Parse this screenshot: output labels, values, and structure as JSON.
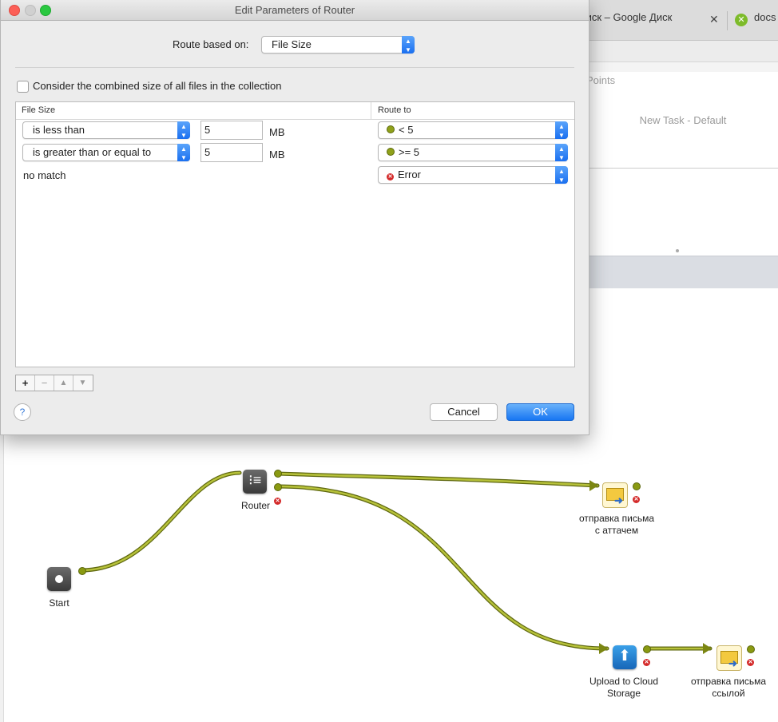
{
  "background_app": {
    "tab_title": "диск – Google Диск",
    "tab_close": "✕",
    "tab2_title": "docs",
    "points_label": "Points",
    "task_title": "New Task - Default"
  },
  "workflow": {
    "start_label": "Start",
    "router_label": "Router",
    "mail_attach_label": "отправка письма с аттачем",
    "upload_label": "Upload to Cloud Storage",
    "mail_link_label": "отправка письма ссылой"
  },
  "dialog": {
    "title": "Edit Parameters of Router",
    "route_based_on_label": "Route based on:",
    "route_based_on_value": "File Size",
    "consider_label": "Consider the combined size of all files in the collection",
    "consider_checked": false,
    "columns": {
      "file_size": "File Size",
      "route_to": "Route to"
    },
    "rows": [
      {
        "condition": "is less than",
        "value": "5",
        "unit": "MB",
        "route": "< 5",
        "route_status": "ok"
      },
      {
        "condition": "is greater than or equal to",
        "value": "5",
        "unit": "MB",
        "route": ">= 5",
        "route_status": "ok"
      }
    ],
    "no_match": {
      "label": "no match",
      "route": "Error",
      "route_status": "error"
    },
    "row_buttons": {
      "add": "+",
      "remove": "−",
      "up": "▲",
      "down": "▼"
    },
    "help": "?",
    "cancel": "Cancel",
    "ok": "OK"
  },
  "colors": {
    "accent": "#1876f2",
    "connector": "#9aa51a",
    "error": "#d42a2a"
  },
  "icons": {
    "router": "router-icon",
    "start": "start-icon",
    "upload": "cloud-upload-icon",
    "mail": "mail-send-icon",
    "port": "output-port-icon",
    "error": "error-icon"
  }
}
